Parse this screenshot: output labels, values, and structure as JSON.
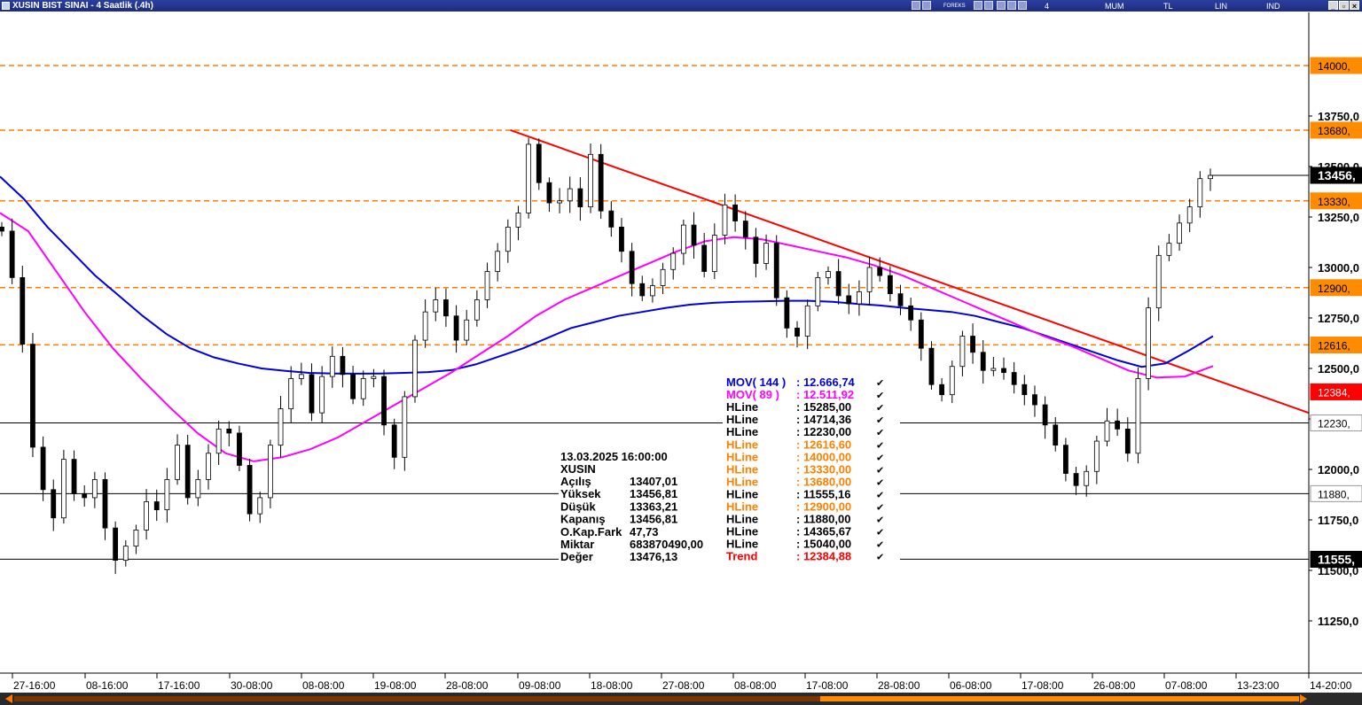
{
  "window": {
    "title": "XUSIN BIST SINAI - 4 Saatlik (.4h)",
    "menu": [
      "4 Saatlik",
      "MUM",
      "TL",
      "LIN",
      "IND"
    ],
    "toolbar_icons": [
      "grid-icon",
      "chart-icon",
      "forex-icon",
      "list-icon",
      "table-icon",
      "tools-icon",
      "gear-icon",
      "zoom-icon",
      "arrow-icon"
    ],
    "window_buttons": [
      "minimize-icon",
      "restore-icon",
      "close-icon"
    ],
    "forex_label": "FOREKS"
  },
  "chart_data": {
    "type": "candlestick",
    "symbol": "XUSIN",
    "x_ticks": [
      "27-16:00",
      "08-16:00",
      "17-16:00",
      "30-08:00",
      "08-08:00",
      "19-08:00",
      "28-08:00",
      "09-08:00",
      "18-08:00",
      "27-08:00",
      "08-08:00",
      "17-08:00",
      "28-08:00",
      "06-08:00",
      "17-08:00",
      "26-08:00",
      "07-08:00",
      "13-23:00",
      "14-20:00"
    ],
    "y_ticks": [
      "13750,0",
      "13500,0",
      "13250,0",
      "13000,0",
      "12750,0",
      "12500,0",
      "12250,0",
      "12000,0",
      "11750,0",
      "11500,0",
      "11250,0"
    ],
    "y_tick_values": [
      13750,
      13500,
      13250,
      13000,
      12750,
      12500,
      12250,
      12000,
      11750,
      11500,
      11250
    ],
    "ylim": [
      11000,
      14300
    ],
    "price_tags": [
      {
        "label": "14000,",
        "value": 14000,
        "style": "orange"
      },
      {
        "label": "13680,",
        "value": 13680,
        "style": "orange"
      },
      {
        "label": "13456,",
        "value": 13456,
        "style": "current"
      },
      {
        "label": "13330,",
        "value": 13330,
        "style": "orange"
      },
      {
        "label": "12900,",
        "value": 12900,
        "style": "orange"
      },
      {
        "label": "12616,",
        "value": 12616,
        "style": "orange"
      },
      {
        "label": "12384,",
        "value": 12384,
        "style": "red"
      },
      {
        "label": "12230,",
        "value": 12230,
        "style": "white"
      },
      {
        "label": "11880,",
        "value": 11880,
        "style": "white"
      },
      {
        "label": "11555,",
        "value": 11555,
        "style": "current"
      }
    ],
    "hlines_orange": [
      14000,
      13680,
      13330,
      12900,
      12616.6
    ],
    "hlines_black": [
      12230,
      11880,
      11555.16
    ],
    "trend": {
      "from": [
        0.39,
        13680
      ],
      "to": [
        1.0,
        12280
      ],
      "color": "#ff0000"
    },
    "closes": [
      13180,
      12950,
      12620,
      12110,
      11900,
      11760,
      12050,
      11880,
      11860,
      11950,
      11710,
      11550,
      11620,
      11700,
      11840,
      11800,
      11950,
      12120,
      11860,
      11950,
      12080,
      12200,
      12180,
      12020,
      11780,
      11860,
      12120,
      12300,
      12450,
      12470,
      12280,
      12460,
      12560,
      12470,
      12350,
      12450,
      12460,
      12220,
      12060,
      12360,
      12640,
      12780,
      12840,
      12760,
      12640,
      12740,
      12840,
      12980,
      13080,
      13200,
      13270,
      13610,
      13420,
      13320,
      13330,
      13390,
      13300,
      13560,
      13280,
      13200,
      13080,
      12920,
      12860,
      12910,
      12990,
      13070,
      13210,
      13110,
      12980,
      13160,
      13310,
      13230,
      13150,
      13020,
      13120,
      12850,
      12700,
      12660,
      12810,
      12950,
      12980,
      12860,
      12820,
      12880,
      13000,
      12960,
      12870,
      12810,
      12740,
      12600,
      12420,
      12370,
      12510,
      12660,
      12580,
      12490,
      12500,
      12480,
      12420,
      12370,
      12320,
      12220,
      12120,
      11980,
      11920,
      11990,
      12140,
      12240,
      12200,
      12080,
      12450,
      12800,
      13060,
      13120,
      13220,
      13300,
      13440,
      13456
    ],
    "series": [
      {
        "name": "MOV( 144 )",
        "color": "#0000dd",
        "values": [
          13450,
          13340,
          13200,
          13080,
          12960,
          12860,
          12760,
          12670,
          12600,
          12555,
          12525,
          12500,
          12488,
          12478,
          12475,
          12474,
          12475,
          12478,
          12482,
          12492,
          12520,
          12560,
          12600,
          12650,
          12700,
          12730,
          12760,
          12780,
          12800,
          12816,
          12825,
          12830,
          12832,
          12835,
          12835,
          12830,
          12820,
          12812,
          12800,
          12790,
          12780,
          12760,
          12730,
          12700,
          12660,
          12620,
          12580,
          12540,
          12508,
          12525,
          12590,
          12660
        ]
      },
      {
        "name": "MOV( 89 )",
        "color": "#ff00ff",
        "values": [
          13270,
          13180,
          12980,
          12780,
          12600,
          12450,
          12310,
          12180,
          12080,
          12040,
          12060,
          12100,
          12160,
          12240,
          12320,
          12400,
          12480,
          12570,
          12660,
          12760,
          12840,
          12900,
          12960,
          13020,
          13080,
          13130,
          13150,
          13140,
          13110,
          13080,
          13050,
          13010,
          12960,
          12900,
          12840,
          12780,
          12720,
          12660,
          12610,
          12550,
          12490,
          12455,
          12460,
          12512
        ]
      }
    ],
    "indicators": [
      {
        "name": "MOV( 144 )",
        "value": "12.666,74",
        "color": "#0000dd"
      },
      {
        "name": "MOV( 89 )",
        "value": "12.511,92",
        "color": "#ff00ff"
      },
      {
        "name": "HLine",
        "value": "15285,00",
        "color": "#000000"
      },
      {
        "name": "HLine",
        "value": "14714,36",
        "color": "#000000"
      },
      {
        "name": "HLine",
        "value": "12230,00",
        "color": "#000000"
      },
      {
        "name": "HLine",
        "value": "12616,60",
        "color": "#ff8000"
      },
      {
        "name": "HLine",
        "value": "14000,00",
        "color": "#ff8000"
      },
      {
        "name": "HLine",
        "value": "13330,00",
        "color": "#ff8000"
      },
      {
        "name": "HLine",
        "value": "13680,00",
        "color": "#ff8000"
      },
      {
        "name": "HLine",
        "value": "11555,16",
        "color": "#000000"
      },
      {
        "name": "HLine",
        "value": "12900,00",
        "color": "#ff8000"
      },
      {
        "name": "HLine",
        "value": "11880,00",
        "color": "#000000"
      },
      {
        "name": "HLine",
        "value": "14365,67",
        "color": "#000000"
      },
      {
        "name": "HLine",
        "value": "15040,00",
        "color": "#000000"
      },
      {
        "name": "Trend",
        "value": "12384,88",
        "color": "#ff0000"
      }
    ],
    "ohlc_info": {
      "datetime": "13.03.2025  16:00:00",
      "symbol": "XUSIN",
      "rows": [
        {
          "label": "Açılış",
          "value": "13407,01"
        },
        {
          "label": "Yüksek",
          "value": "13456,81"
        },
        {
          "label": "Düşük",
          "value": "13363,21"
        },
        {
          "label": "Kapanış",
          "value": "13456,81"
        },
        {
          "label": "O.Kap.Fark",
          "value": "47,73"
        },
        {
          "label": "Miktar",
          "value": "683870490,00"
        },
        {
          "label": "Değer",
          "value": "13476,13"
        }
      ]
    }
  }
}
